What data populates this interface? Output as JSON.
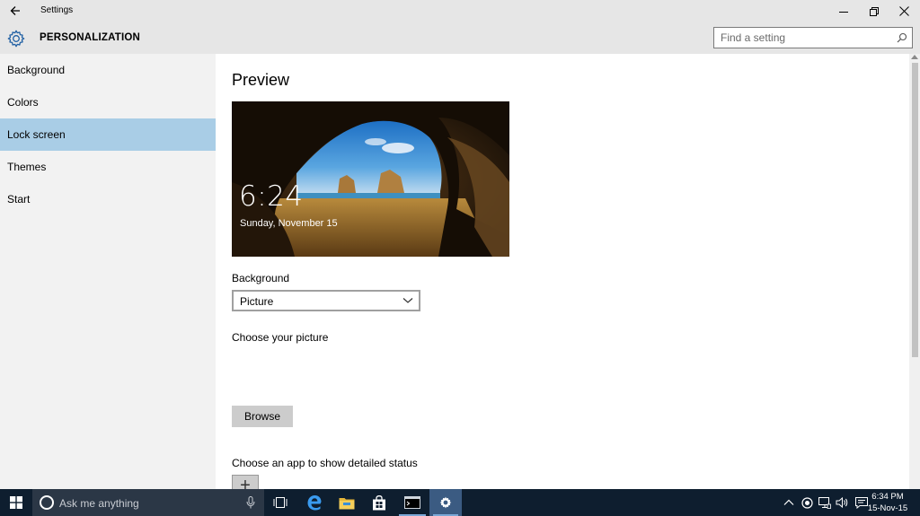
{
  "window": {
    "title": "Settings",
    "back_icon": "back-arrow-icon",
    "controls": [
      "minimize-icon",
      "restore-icon",
      "close-icon"
    ]
  },
  "header": {
    "section_title": "PERSONALIZATION",
    "icon": "gear-icon",
    "search_placeholder": "Find a setting"
  },
  "sidebar": {
    "items": [
      {
        "label": "Background",
        "active": false
      },
      {
        "label": "Colors",
        "active": false
      },
      {
        "label": "Lock screen",
        "active": true
      },
      {
        "label": "Themes",
        "active": false
      },
      {
        "label": "Start",
        "active": false
      }
    ]
  },
  "main": {
    "preview_title": "Preview",
    "preview_time": "6:24",
    "preview_date": "Sunday, November 15",
    "background_label": "Background",
    "background_value": "Picture",
    "choose_picture_label": "Choose your picture",
    "browse_label": "Browse",
    "choose_app_label": "Choose an app to show detailed status",
    "add_app_symbol": "+"
  },
  "taskbar": {
    "search_placeholder": "Ask me anything",
    "pinned": [
      "task-view-icon",
      "edge-icon",
      "file-explorer-icon",
      "store-icon",
      "cmd-icon",
      "settings-icon"
    ],
    "active_app": "settings-icon",
    "tray_icons": [
      "chevron-up-icon",
      "record-icon",
      "network-icon",
      "volume-icon",
      "action-center-icon"
    ],
    "time": "6:34 PM",
    "date": "15-Nov-15"
  },
  "colors": {
    "selected_nav": "#a9cde6",
    "taskbar": "#0e1e2f",
    "titlebar": "#e6e6e6",
    "accent": "#3b5b82"
  }
}
